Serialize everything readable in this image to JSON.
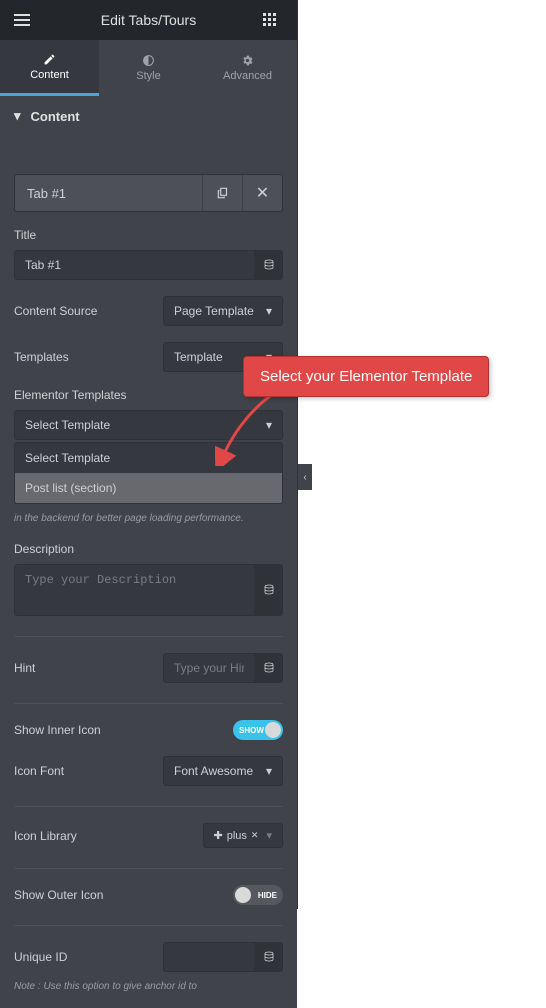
{
  "header": {
    "title": "Edit Tabs/Tours"
  },
  "tabs": {
    "content": "Content",
    "style": "Style",
    "advanced": "Advanced"
  },
  "section": {
    "title": "Content"
  },
  "item": {
    "name": "Tab #1"
  },
  "fields": {
    "title_label": "Title",
    "title_value": "Tab #1",
    "content_source_label": "Content Source",
    "content_source_value": "Page Template",
    "templates_label": "Templates",
    "templates_value": "Template",
    "elementor_templates_label": "Elementor Templates",
    "elementor_templates_value": "Select Template",
    "template_options": {
      "opt1": "Select Template",
      "opt2": "Post list (section)"
    },
    "note": "in the backend for better page loading performance.",
    "description_label": "Description",
    "description_placeholder": "Type your Description",
    "hint_label": "Hint",
    "hint_placeholder": "Type your Hint",
    "show_inner_label": "Show Inner Icon",
    "show_inner_value": "SHOW",
    "icon_font_label": "Icon Font",
    "icon_font_value": "Font Awesome",
    "icon_library_label": "Icon Library",
    "icon_library_value": "plus",
    "show_outer_label": "Show Outer Icon",
    "show_outer_value": "HIDE",
    "unique_id_label": "Unique ID",
    "note2": "Note : Use this option to give anchor id to"
  },
  "callout": {
    "text": "Select your Elementor Template"
  }
}
